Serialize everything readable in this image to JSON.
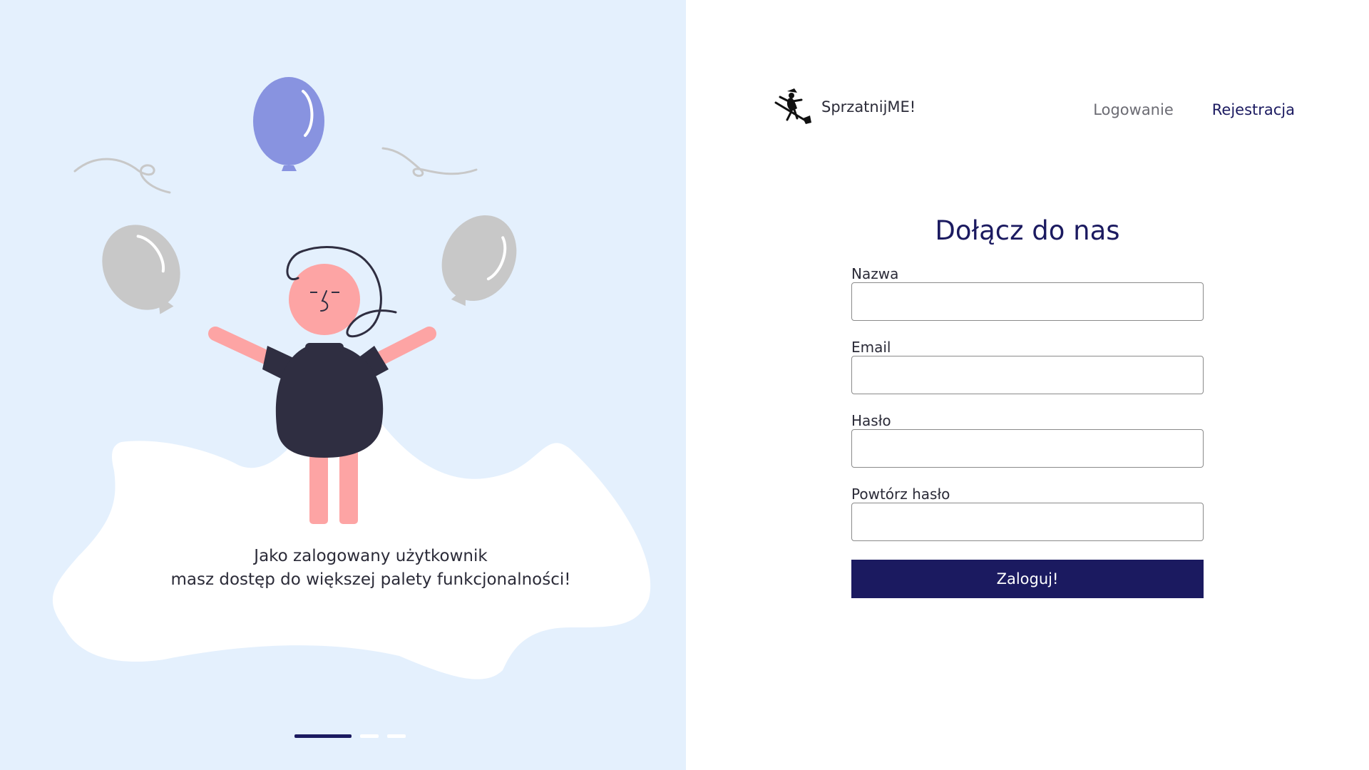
{
  "illustration": {
    "caption_line1": "Jako zalogowany użytkownik",
    "caption_line2": "masz dostęp do większej palety funkcjonalności!",
    "slides_total": 3,
    "active_slide": 1
  },
  "header": {
    "brand_name": "SprzatnijME!",
    "nav": {
      "login": "Logowanie",
      "register": "Rejestracja"
    }
  },
  "form": {
    "title": "Dołącz do nas",
    "fields": {
      "name": {
        "label": "Nazwa",
        "value": ""
      },
      "email": {
        "label": "Email",
        "value": ""
      },
      "password": {
        "label": "Hasło",
        "value": ""
      },
      "repeat_password": {
        "label": "Powtórz hasło",
        "value": ""
      }
    },
    "submit_label": "Zaloguj!"
  },
  "colors": {
    "accent": "#1b1a60",
    "left_background": "#e4f0fd",
    "balloon_blue": "#8893e0",
    "balloon_gray": "#c8c8c8",
    "skin": "#fda4a4",
    "dark": "#2f2e41"
  }
}
